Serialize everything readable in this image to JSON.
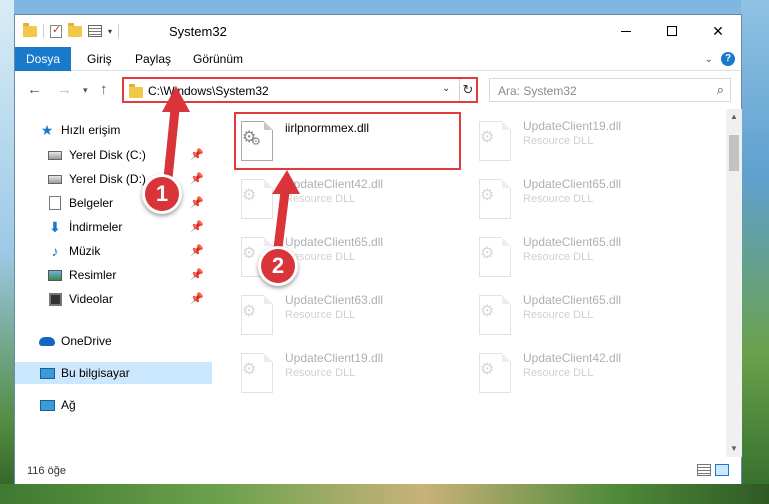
{
  "window": {
    "title": "System32",
    "controls": {
      "minimize": "—",
      "close": "✕"
    }
  },
  "ribbon": {
    "tabs": [
      {
        "label": "Dosya"
      },
      {
        "label": "Giriş"
      },
      {
        "label": "Paylaş"
      },
      {
        "label": "Görünüm"
      }
    ],
    "collapse_icon": "chevron-down-icon",
    "help_label": "?"
  },
  "address": {
    "path": "C:\\Windows\\System32",
    "search_placeholder": "Ara: System32"
  },
  "navigation": {
    "quick_access": {
      "label": "Hızlı erişim",
      "items": [
        {
          "label": "Yerel Disk (C:)",
          "icon": "drive-icon"
        },
        {
          "label": "Yerel Disk (D:)",
          "icon": "drive-icon"
        },
        {
          "label": "Belgeler",
          "icon": "documents-icon"
        },
        {
          "label": "İndirmeler",
          "icon": "downloads-icon"
        },
        {
          "label": "Müzik",
          "icon": "music-icon"
        },
        {
          "label": "Resimler",
          "icon": "pictures-icon"
        },
        {
          "label": "Videolar",
          "icon": "videos-icon"
        }
      ]
    },
    "onedrive": "OneDrive",
    "this_pc": "Bu bilgisayar",
    "network": "Ağ"
  },
  "files": [
    {
      "name": "iirlpnormmex.dll",
      "type": "",
      "highlighted": true
    },
    {
      "name": "UpdateClient19.dll",
      "type": "Resource DLL"
    },
    {
      "name": "UpdateClient42.dll",
      "type": "Resource DLL"
    },
    {
      "name": "UpdateClient65.dll",
      "type": "Resource DLL"
    },
    {
      "name": "UpdateClient65.dll",
      "type": "Resource DLL"
    },
    {
      "name": "UpdateClient65.dll",
      "type": "Resource DLL"
    },
    {
      "name": "UpdateClient63.dll",
      "type": "Resource DLL"
    },
    {
      "name": "UpdateClient65.dll",
      "type": "Resource DLL"
    },
    {
      "name": "UpdateClient19.dll",
      "type": "Resource DLL"
    },
    {
      "name": "UpdateClient42.dll",
      "type": "Resource DLL"
    }
  ],
  "status": {
    "item_count": "116 öğe"
  },
  "annotations": {
    "step1": "1",
    "step2": "2",
    "accent": "#d9343a"
  }
}
